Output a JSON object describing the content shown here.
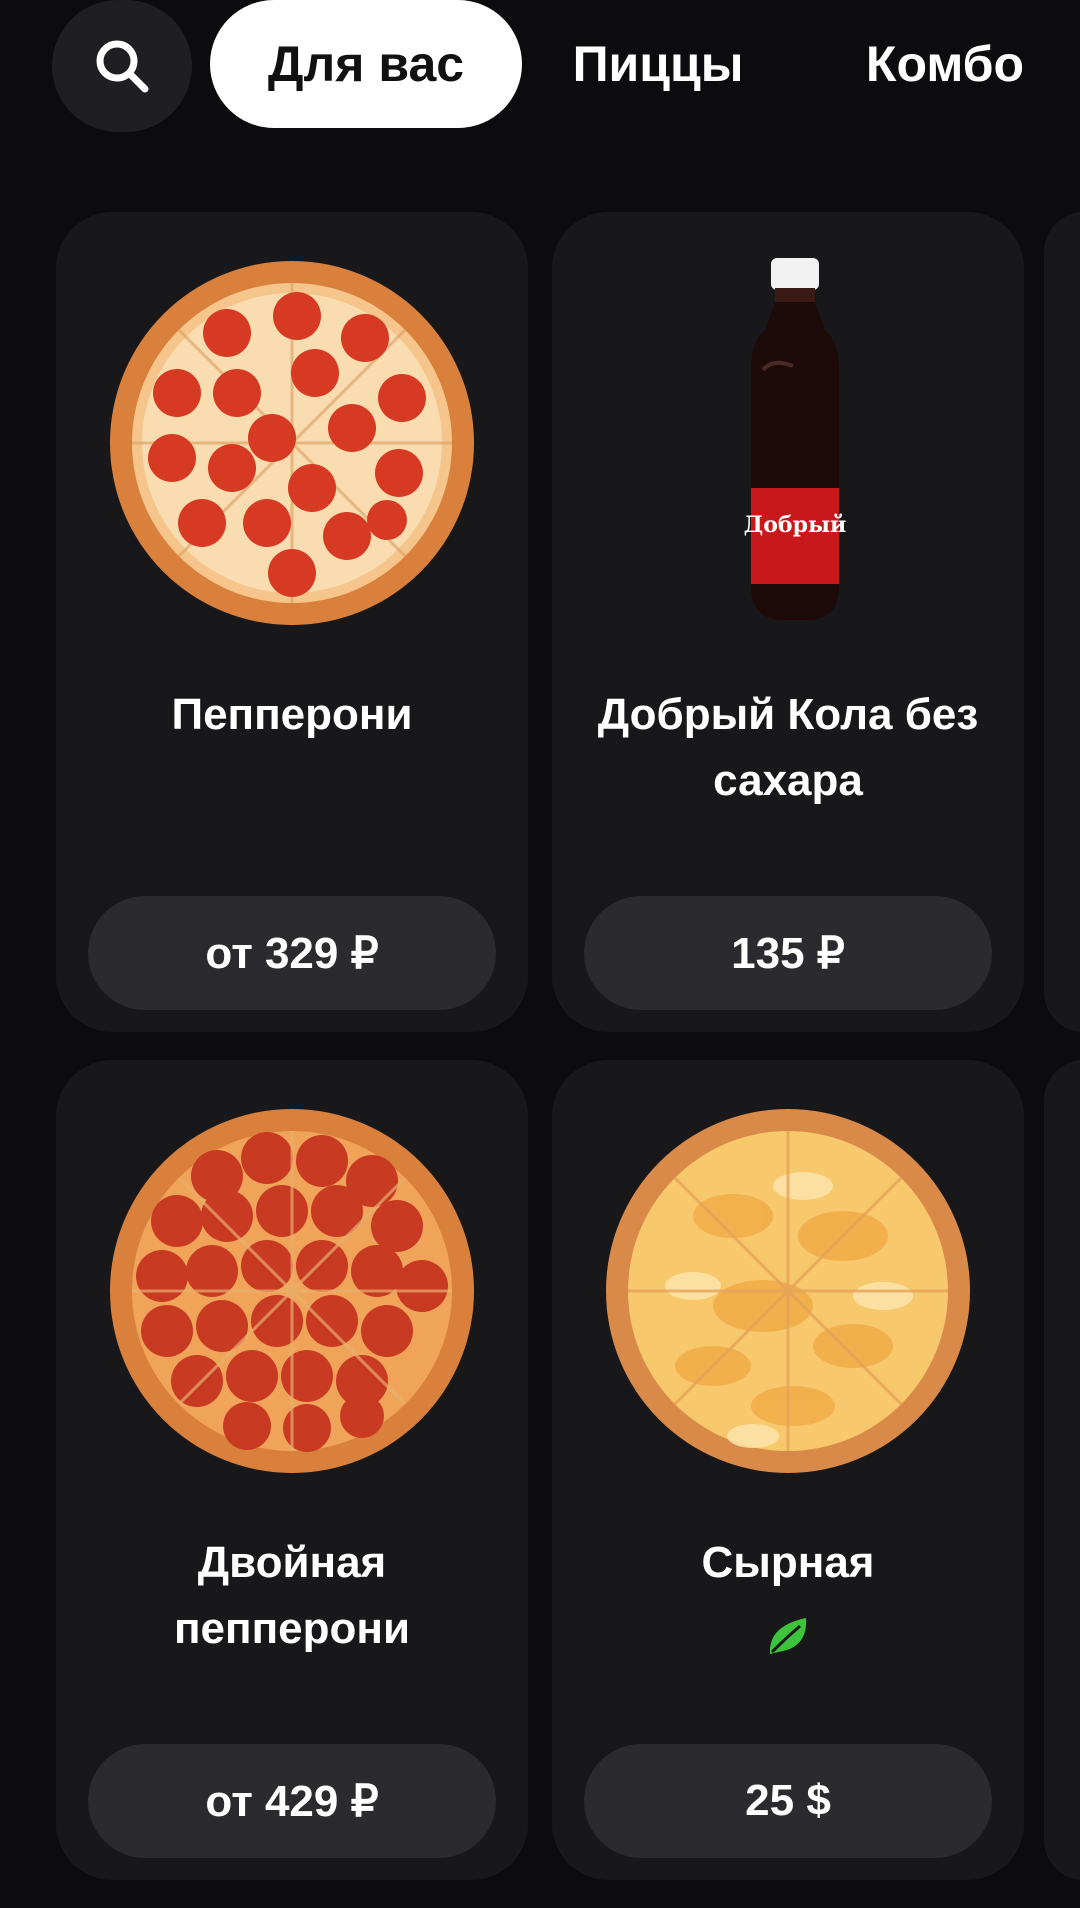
{
  "tabs": [
    {
      "label": "Для вас",
      "active": true
    },
    {
      "label": "Пиццы",
      "active": false
    },
    {
      "label": "Комбо",
      "active": false
    }
  ],
  "search": {
    "icon": "search-icon"
  },
  "products": [
    {
      "title": "Пепперони",
      "price": "от 329 ₽",
      "image": "pepperoni-pizza"
    },
    {
      "title": "Добрый Кола без сахара",
      "price": "135 ₽",
      "image": "cola-bottle",
      "bottle_label": "Добрый"
    },
    {
      "title": "Двойная пепперони",
      "price": "от 429 ₽",
      "image": "double-pepperoni-pizza"
    },
    {
      "title": "Сырная",
      "price": "25 $",
      "image": "cheese-pizza",
      "badge": "leaf-icon"
    }
  ],
  "colors": {
    "background": "#0c0c0e",
    "card": "#18181b",
    "price_button": "#2a2a2f",
    "active_tab": "#ffffff",
    "leaf": "#3cc43c"
  }
}
